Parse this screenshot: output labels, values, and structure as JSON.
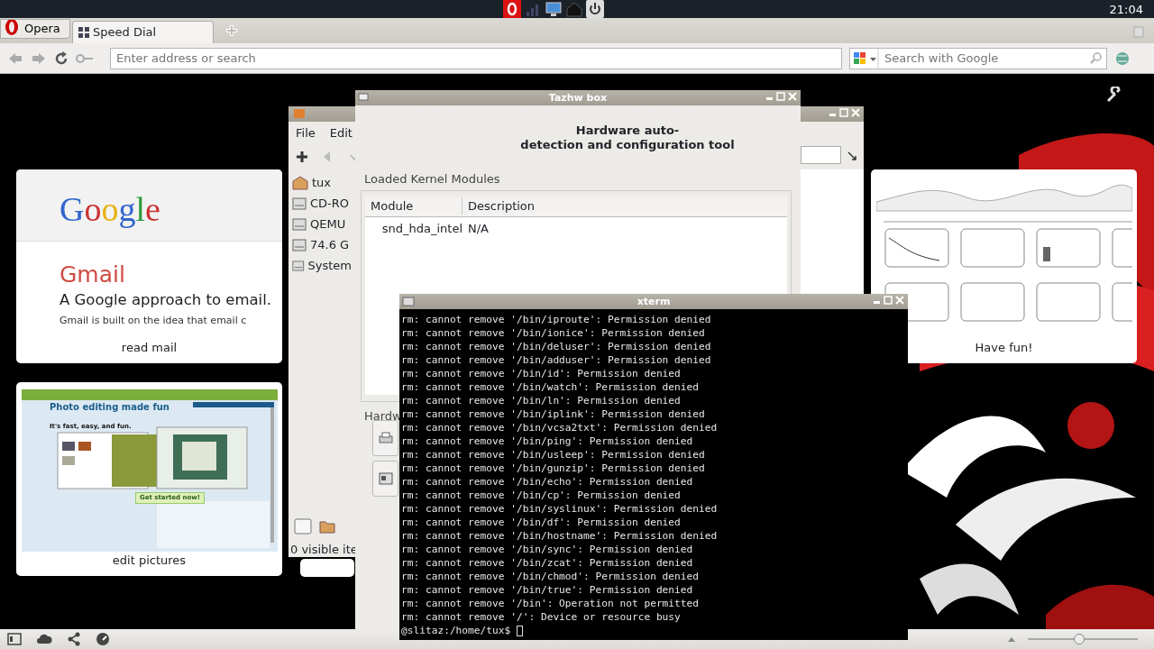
{
  "top_panel": {
    "clock": "21:04"
  },
  "browser": {
    "menu_button": "Opera",
    "tabs": [
      {
        "label": "Speed Dial",
        "selected": true
      }
    ],
    "address_bar": {
      "placeholder": "Enter address or search"
    },
    "search_bar": {
      "placeholder": "Search with Google"
    }
  },
  "speed_dial": [
    {
      "kind": "gmail",
      "caption": "read mail",
      "logo": "Google",
      "title": "Gmail",
      "tagline": "A Google approach to email.",
      "body": "Gmail is built on the idea that email c"
    },
    {
      "kind": "pixlr",
      "caption": "edit pictures",
      "headline": "Photo editing made fun",
      "subline": "It's fast, easy, and fun.",
      "cta": "Get started now!"
    },
    {
      "kind": "canvas",
      "caption": "Have fun!"
    }
  ],
  "file_manager": {
    "menu": [
      "File",
      "Edit"
    ],
    "places": [
      "tux",
      "CD-RO",
      "QEMU",
      "74.6 G",
      "System"
    ],
    "status": "0 visible ite"
  },
  "tazhw_window": {
    "title": "Tazhw box",
    "heading_lines": [
      "Hardware auto-",
      "detection and configuration tool"
    ],
    "group": "Loaded Kernel Modules",
    "columns": [
      "Module",
      "Description"
    ],
    "rows": [
      [
        "snd_hda_intel",
        "N/A"
      ]
    ],
    "section": "Hardw"
  },
  "xterm": {
    "title": "xterm",
    "lines": [
      "rm: cannot remove '/bin/iproute': Permission denied",
      "rm: cannot remove '/bin/ionice': Permission denied",
      "rm: cannot remove '/bin/deluser': Permission denied",
      "rm: cannot remove '/bin/adduser': Permission denied",
      "rm: cannot remove '/bin/id': Permission denied",
      "rm: cannot remove '/bin/watch': Permission denied",
      "rm: cannot remove '/bin/ln': Permission denied",
      "rm: cannot remove '/bin/iplink': Permission denied",
      "rm: cannot remove '/bin/vcsa2txt': Permission denied",
      "rm: cannot remove '/bin/ping': Permission denied",
      "rm: cannot remove '/bin/usleep': Permission denied",
      "rm: cannot remove '/bin/gunzip': Permission denied",
      "rm: cannot remove '/bin/echo': Permission denied",
      "rm: cannot remove '/bin/cp': Permission denied",
      "rm: cannot remove '/bin/syslinux': Permission denied",
      "rm: cannot remove '/bin/df': Permission denied",
      "rm: cannot remove '/bin/hostname': Permission denied",
      "rm: cannot remove '/bin/sync': Permission denied",
      "rm: cannot remove '/bin/zcat': Permission denied",
      "rm: cannot remove '/bin/chmod': Permission denied",
      "rm: cannot remove '/bin/true': Permission denied",
      "rm: cannot remove '/bin': Operation not permitted",
      "rm: cannot remove '/': Device or resource busy"
    ],
    "prompt": "@slitaz:/home/tux$"
  },
  "bottom_panel": {
    "volume": {
      "level": 0.47
    }
  }
}
